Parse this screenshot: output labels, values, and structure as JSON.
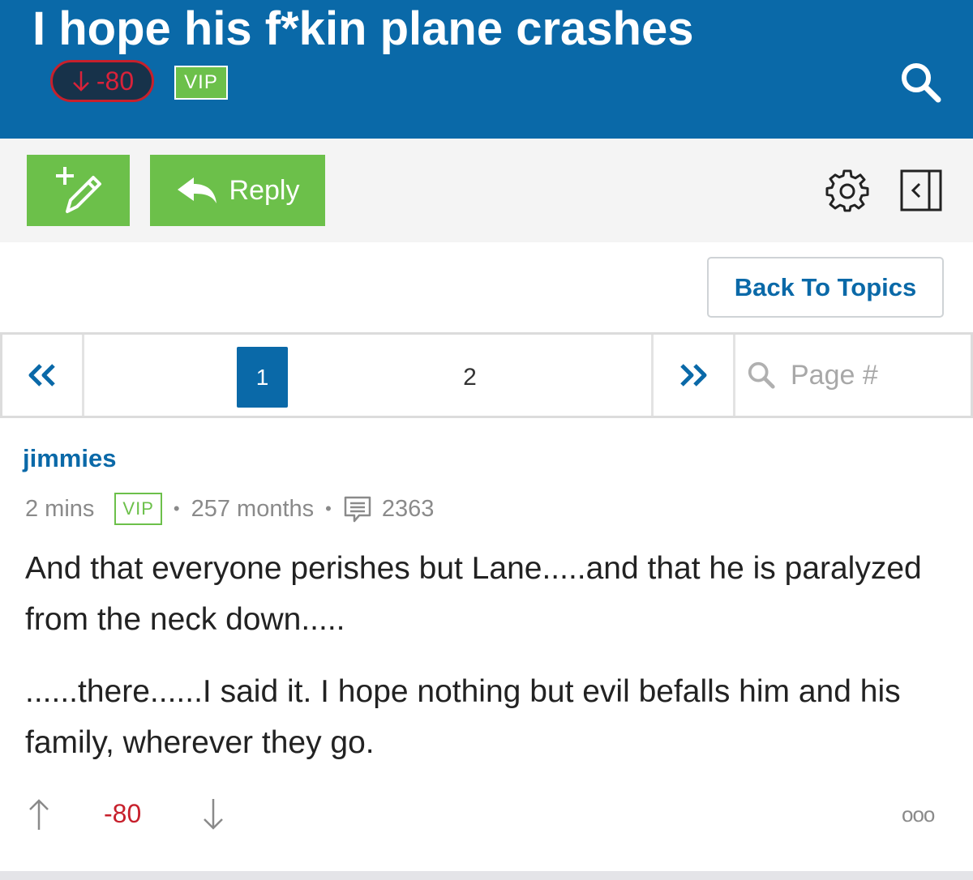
{
  "header": {
    "title": "I hope his f*kin plane crashes",
    "score": "-80",
    "vip_badge": "VIP",
    "search_icon": "search-icon"
  },
  "toolbar": {
    "new_post_icon": "pencil-plus-icon",
    "reply_label": "Reply",
    "reply_icon": "reply-arrow-icon",
    "settings_icon": "gear-icon",
    "panel_icon": "collapse-panel-icon"
  },
  "back_to_topics": "Back To Topics",
  "pagination": {
    "pages": [
      "1",
      "2"
    ],
    "current_page": "1",
    "input_placeholder": "Page #"
  },
  "post": {
    "author": "jimmies",
    "time": "2 mins",
    "vip_badge": "VIP",
    "member_duration": "257 months",
    "post_count": "2363",
    "paragraphs": [
      "And that everyone perishes but Lane.....and that he is paralyzed from the neck down.....",
      "......there......I said it. I hope nothing but evil befalls him and his family, wherever they go."
    ],
    "score": "-80",
    "more_label": "ooo"
  },
  "colors": {
    "brand_blue": "#0a69a8",
    "green": "#6cc04a",
    "negative_red": "#c7202c"
  }
}
